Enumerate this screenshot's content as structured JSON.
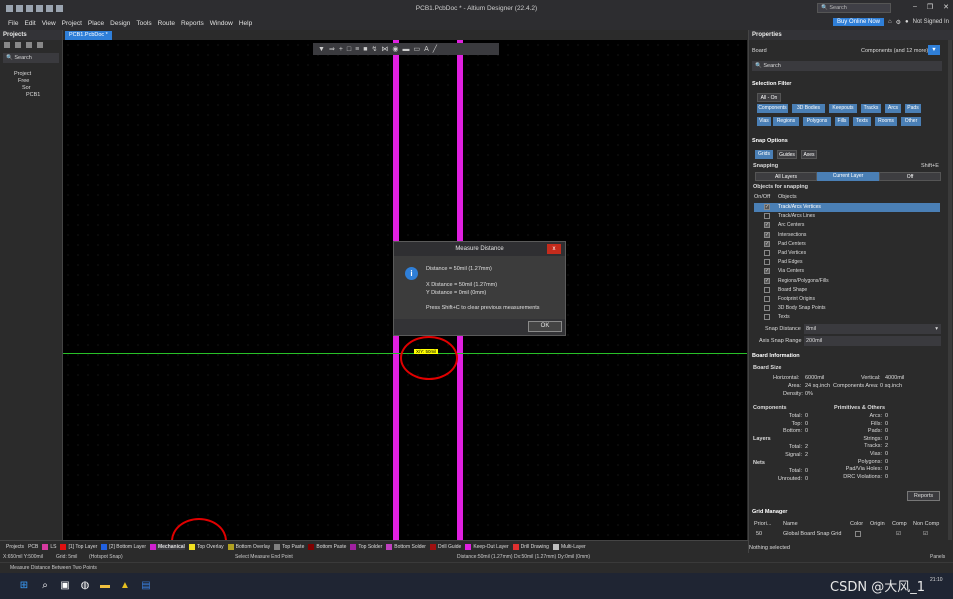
{
  "window": {
    "title": "PCB1.PcbDoc * - Altium Designer (22.4.2)",
    "search_placeholder": "Search",
    "buy_online": "Buy Online Now",
    "signed_in": "Not Signed In"
  },
  "menu": [
    "File",
    "Edit",
    "View",
    "Project",
    "Place",
    "Design",
    "Tools",
    "Route",
    "Reports",
    "Window",
    "Help"
  ],
  "projects_panel": {
    "title": "Projects",
    "search": "Search",
    "tree": [
      "Project",
      "Free",
      "Sor",
      "PCB1"
    ]
  },
  "document_tab": "PCB1.PcbDoc *",
  "canvas": {
    "measure_label": "X/Y: 50mil"
  },
  "dialog": {
    "title": "Measure Distance",
    "close": "x",
    "info_icon": "i",
    "line1": "Distance = 50mil (1.27mm)",
    "line2": "X Distance = 50mil (1.27mm)",
    "line3": "Y Distance = 0mil (0mm)",
    "line4": "Press Shift+C to clear previous measurements",
    "ok": "OK"
  },
  "properties": {
    "title": "Properties",
    "board_label": "Board",
    "components_label": "Components (and 12 more)",
    "search": "Search",
    "selection_filter": {
      "title": "Selection Filter",
      "all_on": "All - On",
      "chips": [
        "Components",
        "3D Bodies",
        "Keepouts",
        "Tracks",
        "Arcs",
        "Pads",
        "Vias",
        "Regions",
        "Polygons",
        "Fills",
        "Texts",
        "Rooms",
        "Other"
      ]
    },
    "snap_options": {
      "title": "Snap Options",
      "tabs": [
        "Grids",
        "Guides",
        "Axes"
      ],
      "snapping": "Snapping",
      "shortcut": "Shift+E",
      "modes": [
        "All Layers",
        "Current Layer",
        "Off"
      ],
      "objects_for_snapping": "Objects for snapping",
      "col_onoff": "On/Off",
      "col_objects": "Objects",
      "objects": [
        {
          "name": "Track/Arcs Vertices",
          "on": true,
          "sel": true
        },
        {
          "name": "Track/Arcs Lines",
          "on": false
        },
        {
          "name": "Arc Centers",
          "on": true
        },
        {
          "name": "Intersections",
          "on": true
        },
        {
          "name": "Pad Centers",
          "on": true
        },
        {
          "name": "Pad Vertices",
          "on": false
        },
        {
          "name": "Pad Edges",
          "on": false
        },
        {
          "name": "Via Centers",
          "on": true
        },
        {
          "name": "Regions/Polygons/Fills",
          "on": true
        },
        {
          "name": "Board Shape",
          "on": false
        },
        {
          "name": "Footprint Origins",
          "on": false
        },
        {
          "name": "3D Body Snap Points",
          "on": false
        },
        {
          "name": "Texts",
          "on": false
        }
      ],
      "snap_distance_label": "Snap Distance",
      "snap_distance": "8mil",
      "axis_snap_label": "Axis Snap Range",
      "axis_snap": "200mil"
    },
    "board_information": {
      "title": "Board Information",
      "board_size": "Board Size",
      "horizontal_label": "Horizontal:",
      "horizontal": "6000mil",
      "vertical_label": "Vertical:",
      "vertical": "4000mil",
      "area_label": "Area:",
      "area": "24 sq.inch",
      "comp_area_label": "Components Area:",
      "comp_area": "0 sq.inch",
      "density_label": "Density:",
      "density": "0%",
      "components": "Components",
      "primitives": "Primitives & Others",
      "comp_rows": [
        [
          "Total:",
          "0"
        ],
        [
          "Top:",
          "0"
        ],
        [
          "Bottom:",
          "0"
        ]
      ],
      "prim_rows": [
        [
          "Arcs:",
          "0"
        ],
        [
          "Fills:",
          "0"
        ],
        [
          "Pads:",
          "0"
        ],
        [
          "Strings:",
          "0"
        ],
        [
          "Tracks:",
          "2"
        ],
        [
          "Vias:",
          "0"
        ],
        [
          "Polygons:",
          "0"
        ],
        [
          "Pad/Via Holes:",
          "0"
        ],
        [
          "DRC Violations:",
          "0"
        ]
      ],
      "layers": "Layers",
      "layer_rows": [
        [
          "Total:",
          "2"
        ],
        [
          "Signal:",
          "2"
        ]
      ],
      "nets": "Nets",
      "net_rows": [
        [
          "Total:",
          "0"
        ],
        [
          "Unrouted:",
          "0"
        ]
      ],
      "reports": "Reports"
    },
    "grid_manager": {
      "title": "Grid Manager",
      "cols": [
        "Priori...",
        "Name",
        "Color",
        "Origin",
        "Comp",
        "Non Comp"
      ],
      "row": [
        "50",
        "Global Board Snap Grid"
      ]
    },
    "nothing_selected": "Nothing selected",
    "panels": "Panels"
  },
  "layers": [
    {
      "name": "LS",
      "color": "#d63aa0"
    },
    {
      "name": "[1] Top Layer",
      "color": "#e01010"
    },
    {
      "name": "[2] Bottom Layer",
      "color": "#2060e0"
    },
    {
      "name": "Mechanical",
      "color": "#d020d0"
    },
    {
      "name": "Top Overlay",
      "color": "#f0e020"
    },
    {
      "name": "Bottom Overlay",
      "color": "#b0a020"
    },
    {
      "name": "Top Paste",
      "color": "#808080"
    },
    {
      "name": "Bottom Paste",
      "color": "#800000"
    },
    {
      "name": "Top Solder",
      "color": "#a020a0"
    },
    {
      "name": "Bottom Solder",
      "color": "#c040c0"
    },
    {
      "name": "Drill Guide",
      "color": "#a01010"
    },
    {
      "name": "Keep-Out Layer",
      "color": "#e020e0"
    },
    {
      "name": "Drill Drawing",
      "color": "#e03030"
    },
    {
      "name": "Multi-Layer",
      "color": "#c0c0c0"
    }
  ],
  "layerbar_prefix": {
    "projects": "Projects",
    "pcb": "PCB"
  },
  "status": {
    "coords": "X:650mil Y:500mil",
    "grid": "Grid: 5mil",
    "hotspot": "(Hotspot Snap)",
    "action": "Select Measure End Point",
    "distance": "Distance:50mil (1.27mm)  Dx:50mil (1.27mm) Dy:0mil (0mm)",
    "hint": "Measure Distance Between Two Points"
  },
  "watermark": "CSDN @大风_1",
  "clock": "21:10"
}
